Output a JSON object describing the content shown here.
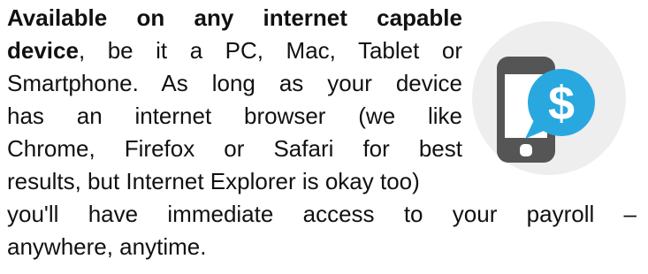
{
  "content": {
    "line1_bold": "Available on any internet capable",
    "line2_bold": "device",
    "line2_rest": ", be it a PC, Mac, Tablet or",
    "line3": "Smartphone. As long as your device",
    "line4": "has an internet browser (we like",
    "line5": "Chrome, Firefox or Safari for best",
    "line6": "results, but Internet Explorer is okay too)",
    "line7": "you'll have immediate access to your payroll –",
    "line8": "anywhere, anytime."
  },
  "icon": {
    "name": "smartphone-dollar-icon",
    "symbol": "$",
    "circle_color": "#eeeeee",
    "phone_color": "#555555",
    "bubble_color": "#29a8e0"
  }
}
